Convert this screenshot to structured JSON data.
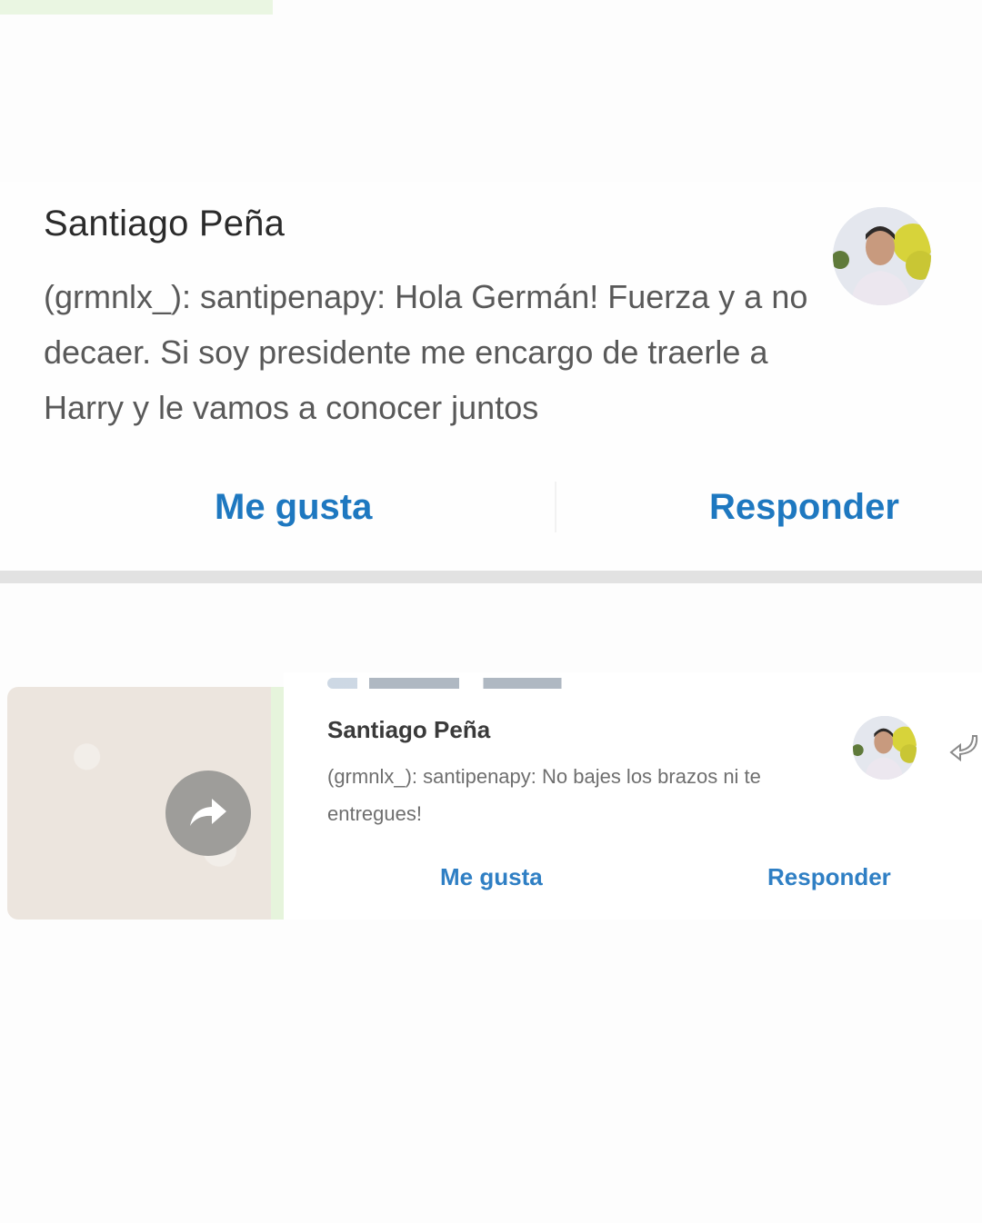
{
  "card1": {
    "sender": "Santiago Peña",
    "message": "(grmnlx_): santipenapy: Hola Germán! Fuerza y a no decaer. Si soy presidente me encargo de traerle a Harry y le vamos a conocer juntos",
    "like_label": "Me gusta",
    "reply_label": "Responder"
  },
  "card2": {
    "sender": "Santiago Peña",
    "message": "(grmnlx_): santipenapy: No bajes los brazos ni te entregues!",
    "like_label": "Me gusta",
    "reply_label": "Responder"
  },
  "icons": {
    "avatar": "profile-photo-icon",
    "forward": "forward-arrow-icon",
    "reply": "reply-arrow-icon"
  },
  "colors": {
    "action_blue": "#1e78c0",
    "sender_text": "#2b2b2b",
    "message_text": "#595959",
    "chat_bg": "#ece5de"
  }
}
